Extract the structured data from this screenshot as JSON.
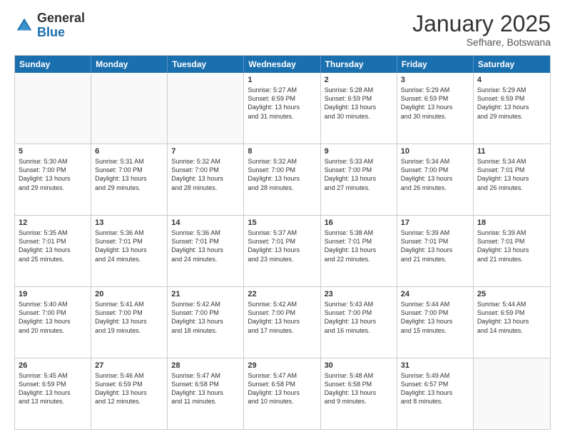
{
  "header": {
    "logo_general": "General",
    "logo_blue": "Blue",
    "month_title": "January 2025",
    "location": "Sefhare, Botswana"
  },
  "weekdays": [
    "Sunday",
    "Monday",
    "Tuesday",
    "Wednesday",
    "Thursday",
    "Friday",
    "Saturday"
  ],
  "weeks": [
    [
      {
        "day": "",
        "info": "",
        "empty": true
      },
      {
        "day": "",
        "info": "",
        "empty": true
      },
      {
        "day": "",
        "info": "",
        "empty": true
      },
      {
        "day": "1",
        "info": "Sunrise: 5:27 AM\nSunset: 6:59 PM\nDaylight: 13 hours\nand 31 minutes.",
        "empty": false
      },
      {
        "day": "2",
        "info": "Sunrise: 5:28 AM\nSunset: 6:59 PM\nDaylight: 13 hours\nand 30 minutes.",
        "empty": false
      },
      {
        "day": "3",
        "info": "Sunrise: 5:29 AM\nSunset: 6:59 PM\nDaylight: 13 hours\nand 30 minutes.",
        "empty": false
      },
      {
        "day": "4",
        "info": "Sunrise: 5:29 AM\nSunset: 6:59 PM\nDaylight: 13 hours\nand 29 minutes.",
        "empty": false
      }
    ],
    [
      {
        "day": "5",
        "info": "Sunrise: 5:30 AM\nSunset: 7:00 PM\nDaylight: 13 hours\nand 29 minutes.",
        "empty": false
      },
      {
        "day": "6",
        "info": "Sunrise: 5:31 AM\nSunset: 7:00 PM\nDaylight: 13 hours\nand 29 minutes.",
        "empty": false
      },
      {
        "day": "7",
        "info": "Sunrise: 5:32 AM\nSunset: 7:00 PM\nDaylight: 13 hours\nand 28 minutes.",
        "empty": false
      },
      {
        "day": "8",
        "info": "Sunrise: 5:32 AM\nSunset: 7:00 PM\nDaylight: 13 hours\nand 28 minutes.",
        "empty": false
      },
      {
        "day": "9",
        "info": "Sunrise: 5:33 AM\nSunset: 7:00 PM\nDaylight: 13 hours\nand 27 minutes.",
        "empty": false
      },
      {
        "day": "10",
        "info": "Sunrise: 5:34 AM\nSunset: 7:00 PM\nDaylight: 13 hours\nand 26 minutes.",
        "empty": false
      },
      {
        "day": "11",
        "info": "Sunrise: 5:34 AM\nSunset: 7:01 PM\nDaylight: 13 hours\nand 26 minutes.",
        "empty": false
      }
    ],
    [
      {
        "day": "12",
        "info": "Sunrise: 5:35 AM\nSunset: 7:01 PM\nDaylight: 13 hours\nand 25 minutes.",
        "empty": false
      },
      {
        "day": "13",
        "info": "Sunrise: 5:36 AM\nSunset: 7:01 PM\nDaylight: 13 hours\nand 24 minutes.",
        "empty": false
      },
      {
        "day": "14",
        "info": "Sunrise: 5:36 AM\nSunset: 7:01 PM\nDaylight: 13 hours\nand 24 minutes.",
        "empty": false
      },
      {
        "day": "15",
        "info": "Sunrise: 5:37 AM\nSunset: 7:01 PM\nDaylight: 13 hours\nand 23 minutes.",
        "empty": false
      },
      {
        "day": "16",
        "info": "Sunrise: 5:38 AM\nSunset: 7:01 PM\nDaylight: 13 hours\nand 22 minutes.",
        "empty": false
      },
      {
        "day": "17",
        "info": "Sunrise: 5:39 AM\nSunset: 7:01 PM\nDaylight: 13 hours\nand 21 minutes.",
        "empty": false
      },
      {
        "day": "18",
        "info": "Sunrise: 5:39 AM\nSunset: 7:01 PM\nDaylight: 13 hours\nand 21 minutes.",
        "empty": false
      }
    ],
    [
      {
        "day": "19",
        "info": "Sunrise: 5:40 AM\nSunset: 7:00 PM\nDaylight: 13 hours\nand 20 minutes.",
        "empty": false
      },
      {
        "day": "20",
        "info": "Sunrise: 5:41 AM\nSunset: 7:00 PM\nDaylight: 13 hours\nand 19 minutes.",
        "empty": false
      },
      {
        "day": "21",
        "info": "Sunrise: 5:42 AM\nSunset: 7:00 PM\nDaylight: 13 hours\nand 18 minutes.",
        "empty": false
      },
      {
        "day": "22",
        "info": "Sunrise: 5:42 AM\nSunset: 7:00 PM\nDaylight: 13 hours\nand 17 minutes.",
        "empty": false
      },
      {
        "day": "23",
        "info": "Sunrise: 5:43 AM\nSunset: 7:00 PM\nDaylight: 13 hours\nand 16 minutes.",
        "empty": false
      },
      {
        "day": "24",
        "info": "Sunrise: 5:44 AM\nSunset: 7:00 PM\nDaylight: 13 hours\nand 15 minutes.",
        "empty": false
      },
      {
        "day": "25",
        "info": "Sunrise: 5:44 AM\nSunset: 6:59 PM\nDaylight: 13 hours\nand 14 minutes.",
        "empty": false
      }
    ],
    [
      {
        "day": "26",
        "info": "Sunrise: 5:45 AM\nSunset: 6:59 PM\nDaylight: 13 hours\nand 13 minutes.",
        "empty": false
      },
      {
        "day": "27",
        "info": "Sunrise: 5:46 AM\nSunset: 6:59 PM\nDaylight: 13 hours\nand 12 minutes.",
        "empty": false
      },
      {
        "day": "28",
        "info": "Sunrise: 5:47 AM\nSunset: 6:58 PM\nDaylight: 13 hours\nand 11 minutes.",
        "empty": false
      },
      {
        "day": "29",
        "info": "Sunrise: 5:47 AM\nSunset: 6:58 PM\nDaylight: 13 hours\nand 10 minutes.",
        "empty": false
      },
      {
        "day": "30",
        "info": "Sunrise: 5:48 AM\nSunset: 6:58 PM\nDaylight: 13 hours\nand 9 minutes.",
        "empty": false
      },
      {
        "day": "31",
        "info": "Sunrise: 5:49 AM\nSunset: 6:57 PM\nDaylight: 13 hours\nand 8 minutes.",
        "empty": false
      },
      {
        "day": "",
        "info": "",
        "empty": true
      }
    ]
  ]
}
